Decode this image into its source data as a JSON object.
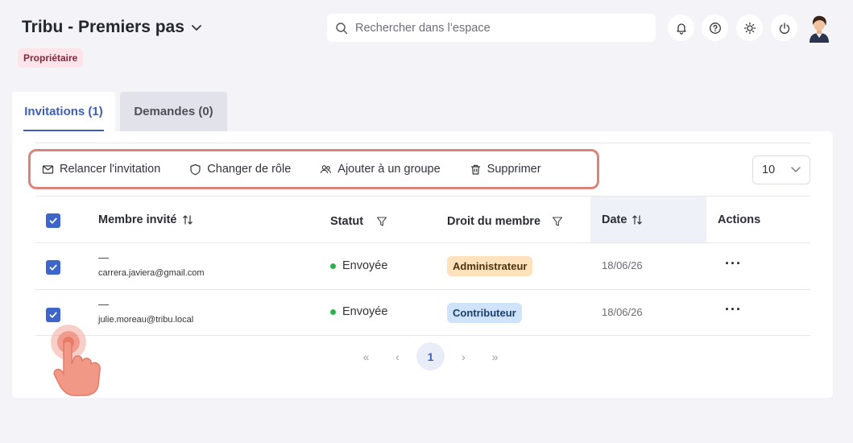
{
  "header": {
    "title": "Tribu - Premiers pas",
    "role_badge": "Propriétaire"
  },
  "search": {
    "placeholder": "Rechercher dans l’espace"
  },
  "header_icons": [
    "bell-icon",
    "help-icon",
    "sun-icon",
    "power-icon"
  ],
  "tabs": [
    {
      "label": "Invitations (1)",
      "active": true
    },
    {
      "label": "Demandes (0)",
      "active": false
    }
  ],
  "toolbar": {
    "resend": "Relancer l'invitation",
    "change_role": "Changer de rôle",
    "add_group": "Ajouter à un groupe",
    "delete": "Supprimer"
  },
  "page_size": {
    "value": "10"
  },
  "table": {
    "columns": {
      "member": "Membre invité",
      "status": "Statut",
      "role": "Droit du membre",
      "date": "Date",
      "actions": "Actions"
    },
    "rows": [
      {
        "name": "—",
        "email": "carrera.javiera@gmail.com",
        "status": "Envoyée",
        "role": "Administrateur",
        "date": "18/06/26",
        "actions": "···"
      },
      {
        "name": "—",
        "email": "julie.moreau@tribu.local",
        "status": "Envoyée",
        "role": "Contributeur",
        "date": "18/06/26",
        "actions": "···"
      }
    ]
  },
  "pagination": {
    "first": "«",
    "prev": "‹",
    "current": "1",
    "next": "›",
    "last": "»"
  },
  "colors": {
    "accent": "#3e5fb8",
    "checkbox": "#3e66c8",
    "toolbar_highlight": "#d9857a",
    "status_sent": "#2fb24c",
    "admin_badge": "#fde2bd",
    "contrib_badge": "#cfe3fb",
    "owner_badge": "#fde3ea"
  }
}
